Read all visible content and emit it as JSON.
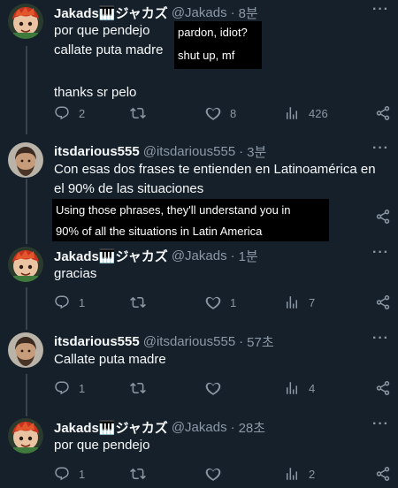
{
  "tweets": [
    {
      "name": "Jakads🎹ジャカズ",
      "handle": "@Jakads",
      "time": "8분",
      "lines": [
        "por que pendejo",
        "callate puta madre",
        "",
        "thanks sr pelo"
      ],
      "note_lines": [
        "pardon, idiot?",
        "shut up, mf"
      ],
      "replies": "2",
      "retweets": "",
      "likes": "8",
      "views": "426"
    },
    {
      "name": "itsdarious555",
      "handle": "@itsdarious555",
      "time": "3분",
      "lines": [
        "Con esas dos frases te entienden en Latinoamérica en",
        "el 90% de las situaciones"
      ],
      "note_lines": [
        "Using those phrases, they'll understand you in",
        "90% of all the situations in Latin America"
      ],
      "replies": "",
      "retweets": "",
      "likes": "",
      "views": ""
    },
    {
      "name": "Jakads🎹ジャカズ",
      "handle": "@Jakads",
      "time": "1분",
      "lines": [
        "gracias"
      ],
      "replies": "1",
      "retweets": "",
      "likes": "1",
      "views": "7"
    },
    {
      "name": "itsdarious555",
      "handle": "@itsdarious555",
      "time": "57초",
      "lines": [
        "Callate puta madre"
      ],
      "replies": "1",
      "retweets": "",
      "likes": "",
      "views": "4"
    },
    {
      "name": "Jakads🎹ジャカズ",
      "handle": "@Jakads",
      "time": "28초",
      "lines": [
        "por que pendejo"
      ],
      "replies": "1",
      "retweets": "",
      "likes": "",
      "views": "2"
    }
  ],
  "separator": "·",
  "more_glyph": "···",
  "icons": [
    "reply-icon",
    "retweet-icon",
    "like-icon",
    "views-icon",
    "share-icon"
  ],
  "colors": {
    "background": "#15202b",
    "text": "#f7f9f9",
    "muted": "#8b98a5",
    "thread_line": "#38444d",
    "note_bg": "#000000"
  }
}
